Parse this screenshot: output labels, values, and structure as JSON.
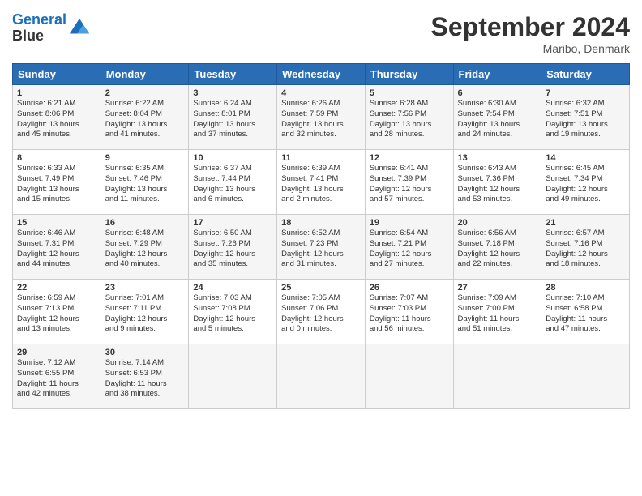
{
  "header": {
    "logo_line1": "General",
    "logo_line2": "Blue",
    "month_title": "September 2024",
    "location": "Maribo, Denmark"
  },
  "weekdays": [
    "Sunday",
    "Monday",
    "Tuesday",
    "Wednesday",
    "Thursday",
    "Friday",
    "Saturday"
  ],
  "rows": [
    [
      {
        "day": "1",
        "lines": [
          "Sunrise: 6:21 AM",
          "Sunset: 8:06 PM",
          "Daylight: 13 hours",
          "and 45 minutes."
        ]
      },
      {
        "day": "2",
        "lines": [
          "Sunrise: 6:22 AM",
          "Sunset: 8:04 PM",
          "Daylight: 13 hours",
          "and 41 minutes."
        ]
      },
      {
        "day": "3",
        "lines": [
          "Sunrise: 6:24 AM",
          "Sunset: 8:01 PM",
          "Daylight: 13 hours",
          "and 37 minutes."
        ]
      },
      {
        "day": "4",
        "lines": [
          "Sunrise: 6:26 AM",
          "Sunset: 7:59 PM",
          "Daylight: 13 hours",
          "and 32 minutes."
        ]
      },
      {
        "day": "5",
        "lines": [
          "Sunrise: 6:28 AM",
          "Sunset: 7:56 PM",
          "Daylight: 13 hours",
          "and 28 minutes."
        ]
      },
      {
        "day": "6",
        "lines": [
          "Sunrise: 6:30 AM",
          "Sunset: 7:54 PM",
          "Daylight: 13 hours",
          "and 24 minutes."
        ]
      },
      {
        "day": "7",
        "lines": [
          "Sunrise: 6:32 AM",
          "Sunset: 7:51 PM",
          "Daylight: 13 hours",
          "and 19 minutes."
        ]
      }
    ],
    [
      {
        "day": "8",
        "lines": [
          "Sunrise: 6:33 AM",
          "Sunset: 7:49 PM",
          "Daylight: 13 hours",
          "and 15 minutes."
        ]
      },
      {
        "day": "9",
        "lines": [
          "Sunrise: 6:35 AM",
          "Sunset: 7:46 PM",
          "Daylight: 13 hours",
          "and 11 minutes."
        ]
      },
      {
        "day": "10",
        "lines": [
          "Sunrise: 6:37 AM",
          "Sunset: 7:44 PM",
          "Daylight: 13 hours",
          "and 6 minutes."
        ]
      },
      {
        "day": "11",
        "lines": [
          "Sunrise: 6:39 AM",
          "Sunset: 7:41 PM",
          "Daylight: 13 hours",
          "and 2 minutes."
        ]
      },
      {
        "day": "12",
        "lines": [
          "Sunrise: 6:41 AM",
          "Sunset: 7:39 PM",
          "Daylight: 12 hours",
          "and 57 minutes."
        ]
      },
      {
        "day": "13",
        "lines": [
          "Sunrise: 6:43 AM",
          "Sunset: 7:36 PM",
          "Daylight: 12 hours",
          "and 53 minutes."
        ]
      },
      {
        "day": "14",
        "lines": [
          "Sunrise: 6:45 AM",
          "Sunset: 7:34 PM",
          "Daylight: 12 hours",
          "and 49 minutes."
        ]
      }
    ],
    [
      {
        "day": "15",
        "lines": [
          "Sunrise: 6:46 AM",
          "Sunset: 7:31 PM",
          "Daylight: 12 hours",
          "and 44 minutes."
        ]
      },
      {
        "day": "16",
        "lines": [
          "Sunrise: 6:48 AM",
          "Sunset: 7:29 PM",
          "Daylight: 12 hours",
          "and 40 minutes."
        ]
      },
      {
        "day": "17",
        "lines": [
          "Sunrise: 6:50 AM",
          "Sunset: 7:26 PM",
          "Daylight: 12 hours",
          "and 35 minutes."
        ]
      },
      {
        "day": "18",
        "lines": [
          "Sunrise: 6:52 AM",
          "Sunset: 7:23 PM",
          "Daylight: 12 hours",
          "and 31 minutes."
        ]
      },
      {
        "day": "19",
        "lines": [
          "Sunrise: 6:54 AM",
          "Sunset: 7:21 PM",
          "Daylight: 12 hours",
          "and 27 minutes."
        ]
      },
      {
        "day": "20",
        "lines": [
          "Sunrise: 6:56 AM",
          "Sunset: 7:18 PM",
          "Daylight: 12 hours",
          "and 22 minutes."
        ]
      },
      {
        "day": "21",
        "lines": [
          "Sunrise: 6:57 AM",
          "Sunset: 7:16 PM",
          "Daylight: 12 hours",
          "and 18 minutes."
        ]
      }
    ],
    [
      {
        "day": "22",
        "lines": [
          "Sunrise: 6:59 AM",
          "Sunset: 7:13 PM",
          "Daylight: 12 hours",
          "and 13 minutes."
        ]
      },
      {
        "day": "23",
        "lines": [
          "Sunrise: 7:01 AM",
          "Sunset: 7:11 PM",
          "Daylight: 12 hours",
          "and 9 minutes."
        ]
      },
      {
        "day": "24",
        "lines": [
          "Sunrise: 7:03 AM",
          "Sunset: 7:08 PM",
          "Daylight: 12 hours",
          "and 5 minutes."
        ]
      },
      {
        "day": "25",
        "lines": [
          "Sunrise: 7:05 AM",
          "Sunset: 7:06 PM",
          "Daylight: 12 hours",
          "and 0 minutes."
        ]
      },
      {
        "day": "26",
        "lines": [
          "Sunrise: 7:07 AM",
          "Sunset: 7:03 PM",
          "Daylight: 11 hours",
          "and 56 minutes."
        ]
      },
      {
        "day": "27",
        "lines": [
          "Sunrise: 7:09 AM",
          "Sunset: 7:00 PM",
          "Daylight: 11 hours",
          "and 51 minutes."
        ]
      },
      {
        "day": "28",
        "lines": [
          "Sunrise: 7:10 AM",
          "Sunset: 6:58 PM",
          "Daylight: 11 hours",
          "and 47 minutes."
        ]
      }
    ],
    [
      {
        "day": "29",
        "lines": [
          "Sunrise: 7:12 AM",
          "Sunset: 6:55 PM",
          "Daylight: 11 hours",
          "and 42 minutes."
        ]
      },
      {
        "day": "30",
        "lines": [
          "Sunrise: 7:14 AM",
          "Sunset: 6:53 PM",
          "Daylight: 11 hours",
          "and 38 minutes."
        ]
      },
      {
        "day": "",
        "lines": []
      },
      {
        "day": "",
        "lines": []
      },
      {
        "day": "",
        "lines": []
      },
      {
        "day": "",
        "lines": []
      },
      {
        "day": "",
        "lines": []
      }
    ]
  ]
}
